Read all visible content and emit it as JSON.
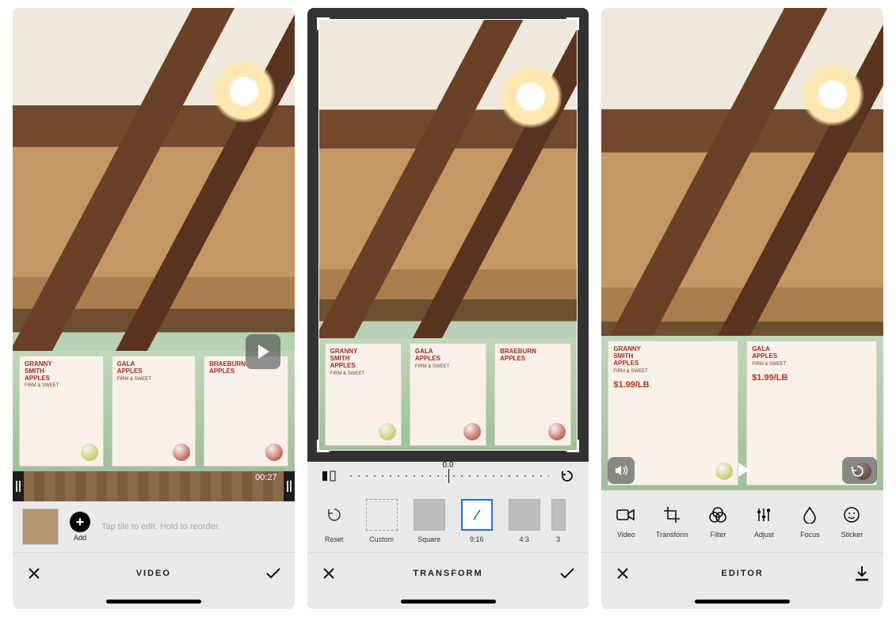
{
  "panel1": {
    "duration": "00:27",
    "add_label": "Add",
    "hint": "Tap tile to edit. Hold to reorder.",
    "bar_title": "VIDEO"
  },
  "panel2": {
    "rotation_value": "0.0",
    "bar_title": "TRANSFORM",
    "ratios": {
      "reset": "Reset",
      "custom": "Custom",
      "square": "Square",
      "r916": "9:16",
      "r43": "4:3",
      "r3": "3"
    }
  },
  "panel3": {
    "bar_title": "EDITOR",
    "tools": {
      "video": "Video",
      "transform": "Transform",
      "filter": "Filter",
      "adjust": "Adjust",
      "focus": "Focus",
      "sticker": "Sticker"
    }
  },
  "signs": {
    "granny_title": "GRANNY\nSMITH\nAPPLES",
    "granny_sub": "FIRM & SWEET",
    "gala_title": "GALA\nAPPLES",
    "gala_sub": "FIRM & SWEET",
    "brae_title": "BRAEBURN\nAPPLES",
    "price": "$1.99/LB"
  }
}
